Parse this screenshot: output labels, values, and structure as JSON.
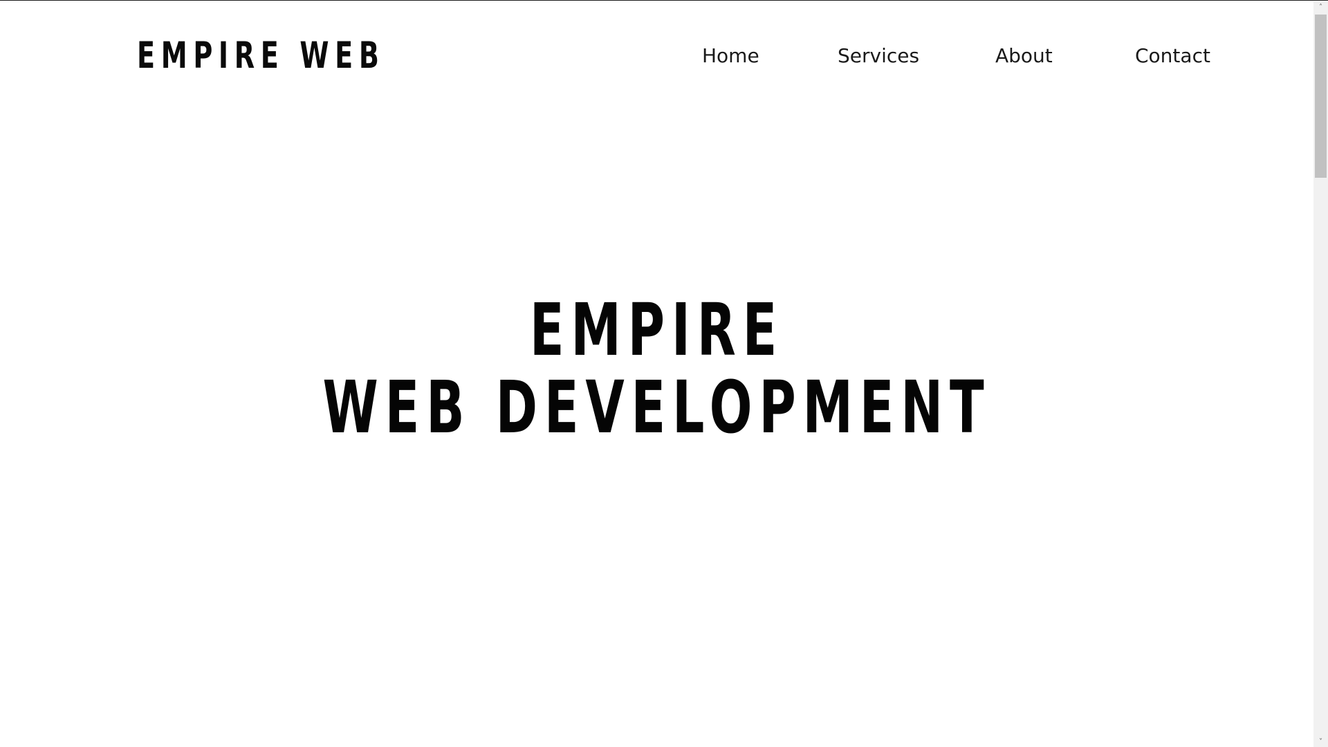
{
  "header": {
    "logo_text": "EMPIRE WEB",
    "nav": {
      "home": "Home",
      "services": "Services",
      "about": "About",
      "contact": "Contact"
    }
  },
  "hero": {
    "line1": "EMPIRE",
    "line2": "WEB DEVELOPMENT"
  },
  "scrollbar": {
    "up_icon": "chevron-up-icon",
    "down_icon": "chevron-down-icon",
    "up_glyph": "˄",
    "down_glyph": "˅"
  },
  "colors": {
    "background": "#ffffff",
    "text": "#0a0a0a",
    "scrollbar_track": "#f1f1f1",
    "scrollbar_thumb": "#c1c1c1"
  }
}
